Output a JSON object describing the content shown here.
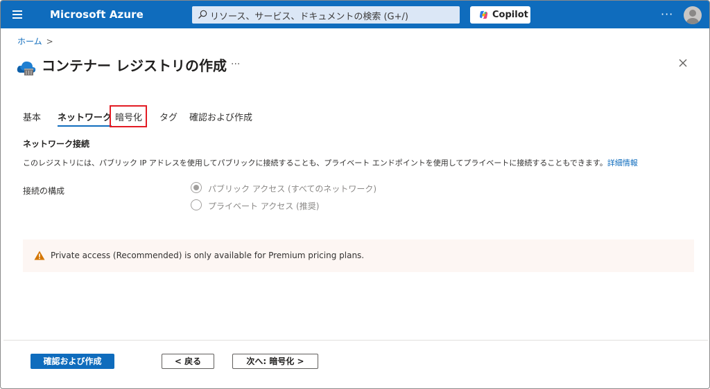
{
  "topbar": {
    "menu_icon": "hamburger-menu-icon",
    "brand": "Microsoft Azure",
    "search_placeholder": "リソース、サービス、ドキュメントの検索 (G+/)",
    "copilot_label": "Copilot",
    "more": "···",
    "accent_color": "#0f6cbd"
  },
  "breadcrumb": {
    "home": "ホーム",
    "separator": ">"
  },
  "header": {
    "title": "コンテナー レジストリの作成",
    "more": "···",
    "title_icon": "container-registry-icon",
    "close_icon": "close-icon"
  },
  "tabs": [
    {
      "label": "基本",
      "active": false
    },
    {
      "label": "ネットワーク",
      "active": true
    },
    {
      "label": "暗号化",
      "active": false
    },
    {
      "label": "タグ",
      "active": false
    },
    {
      "label": "確認および作成",
      "active": false
    }
  ],
  "network": {
    "section_title": "ネットワーク接続",
    "description": "このレジストリには、パブリック IP アドレスを使用してパブリックに接続することも、プライベート エンドポイントを使用してプライベートに接続することもできます。",
    "learn_more": "詳細情報",
    "config_label": "接続の構成",
    "options": [
      {
        "label": "パブリック アクセス (すべてのネットワーク)",
        "checked": true,
        "disabled": true
      },
      {
        "label": "プライベート アクセス (推奨)",
        "checked": false,
        "disabled": true
      }
    ]
  },
  "warning": {
    "icon": "warning-icon",
    "text": "Private access (Recommended) is only available for Premium pricing plans.",
    "icon_color": "#d47500",
    "background": "#fdf6f3"
  },
  "footer": {
    "review_create": "確認および作成",
    "back": "< 戻る",
    "next": "次へ: 暗号化 >"
  }
}
